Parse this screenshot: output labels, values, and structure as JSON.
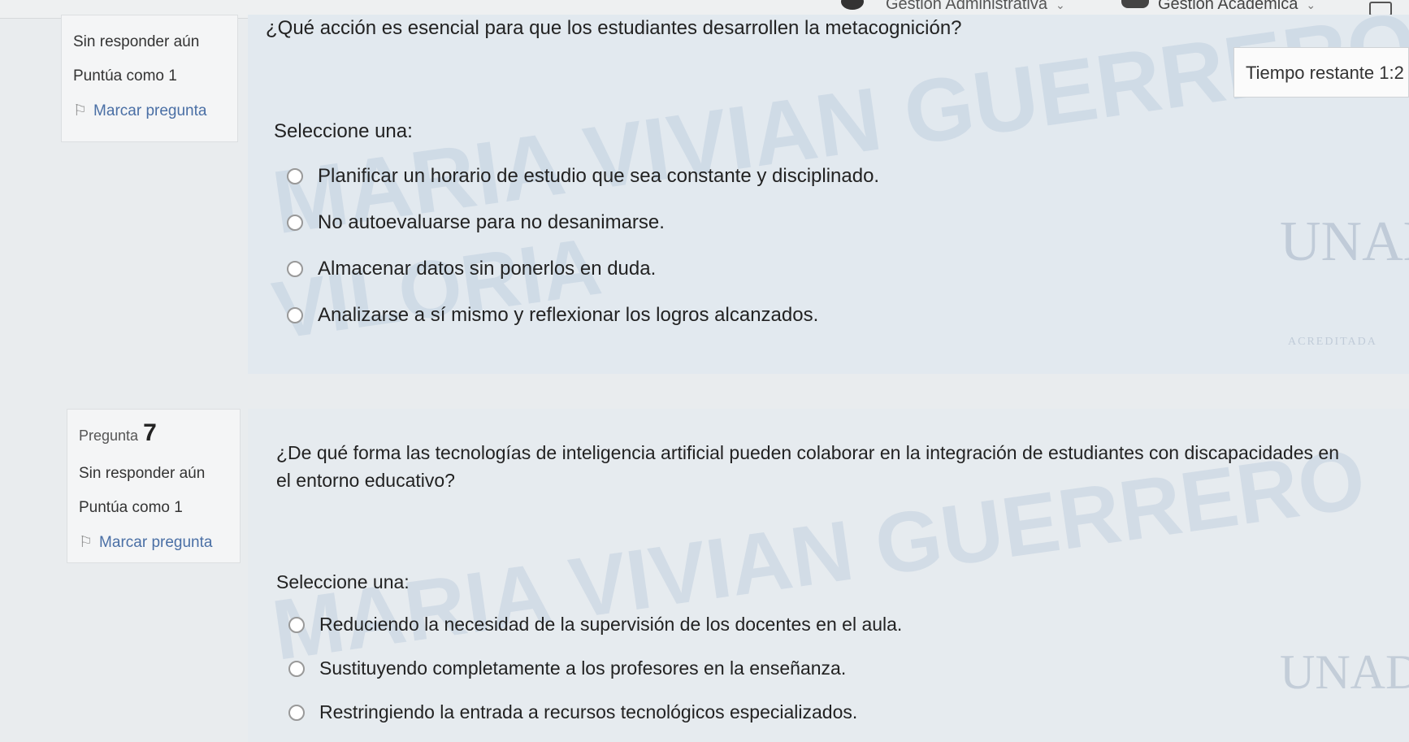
{
  "topbar": {
    "admin_label": "Gestión Administrativa",
    "academic_label": "Gestión Académica",
    "chevron": "⌄"
  },
  "timer": {
    "label": "Tiempo restante 1:2"
  },
  "question6": {
    "status": "Sin responder aún",
    "score": "Puntúa como 1",
    "flag_label": "Marcar pregunta",
    "text": "¿Qué acción es esencial para que los estudiantes desarrollen la metacognición?",
    "select_label": "Seleccione una:",
    "options": [
      "Planificar un horario de estudio que sea constante y disciplinado.",
      "No autoevaluarse para no desanimarse.",
      "Almacenar datos sin ponerlos en duda.",
      "Analizarse a sí mismo y reflexionar los logros alcanzados."
    ]
  },
  "question7": {
    "number_label": "Pregunta",
    "number": "7",
    "status": "Sin responder aún",
    "score": "Puntúa como 1",
    "flag_label": "Marcar pregunta",
    "text_line1": "¿De qué forma las tecnologías de inteligencia artificial pueden colaborar en la integración de estudiantes con discapacidades en",
    "text_line2": "el entorno educativo?",
    "select_label": "Seleccione una:",
    "options": [
      "Reduciendo la necesidad de la supervisión de los docentes en el aula.",
      "Sustituyendo completamente a los profesores en la enseñanza.",
      "Restringiendo la entrada a recursos tecnológicos especializados."
    ]
  },
  "watermark": {
    "line1": "MARIA VIVIAN GUERRERO",
    "line2": "VILORIA",
    "logo": "UNAD",
    "logo_sub": "ACREDITADA"
  },
  "icons": {
    "flag": "flag-icon",
    "mortarboard": "mortarboard-icon",
    "mail": "mail-icon",
    "radio": "radio-icon"
  },
  "colors": {
    "content_bg": "#e2e9ef",
    "flag_link": "#4a6fa5"
  }
}
